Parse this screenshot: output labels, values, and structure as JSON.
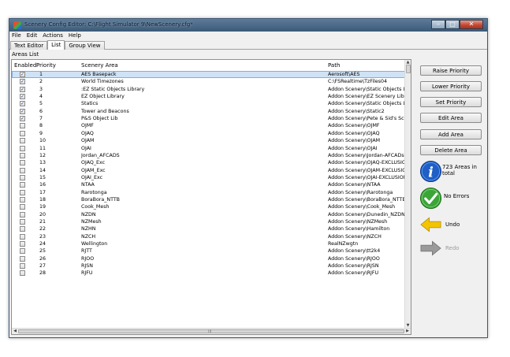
{
  "window": {
    "title": "Scenery Config Editor: C:\\Flight Simulator 9\\NewScenery.cfg*",
    "minimize": "–",
    "maximize": "□",
    "close": "✕"
  },
  "menu": [
    "File",
    "Edit",
    "Actions",
    "Help"
  ],
  "tabs": [
    "Text Editor",
    "List",
    "Group View"
  ],
  "group_label": "Areas List",
  "columns": {
    "enabled": "Enabled",
    "priority": "Priority",
    "area": "Scenery Area",
    "path": "Path"
  },
  "rows": [
    {
      "enabled": true,
      "priority": "1",
      "area": "AES Basepack",
      "path": "Aerosoft\\AES"
    },
    {
      "enabled": true,
      "priority": "2",
      "area": "World Timezones",
      "path": "C:\\FSRealtime\\TzFiles04"
    },
    {
      "enabled": true,
      "priority": "3",
      "area": ":EZ Static Objects Library",
      "path": "Addon Scenery\\Static Objects Libr"
    },
    {
      "enabled": true,
      "priority": "4",
      "area": "EZ Object Library",
      "path": "Addon Scenery\\EZ Scenery Library"
    },
    {
      "enabled": true,
      "priority": "5",
      "area": "Statics",
      "path": "Addon Scenery\\Static Objects Libr"
    },
    {
      "enabled": true,
      "priority": "6",
      "area": "Tower and Beacons",
      "path": "Addon Scenery\\Static2"
    },
    {
      "enabled": true,
      "priority": "7",
      "area": "P&S Object Lib",
      "path": "Addon Scenery\\Pete & Sid's Scen"
    },
    {
      "enabled": false,
      "priority": "8",
      "area": "OJMF",
      "path": "Addon Scenery\\OJMF"
    },
    {
      "enabled": false,
      "priority": "9",
      "area": "OJAQ",
      "path": "Addon Scenery\\OJAQ"
    },
    {
      "enabled": false,
      "priority": "10",
      "area": "OJAM",
      "path": "Addon Scenery\\OJAM"
    },
    {
      "enabled": false,
      "priority": "11",
      "area": "OJAI",
      "path": "Addon Scenery\\OJAI"
    },
    {
      "enabled": false,
      "priority": "12",
      "area": "Jordan_AFCADS",
      "path": "Addon Scenery\\Jordan-AFCADs-L"
    },
    {
      "enabled": false,
      "priority": "13",
      "area": "OJAQ_Exc",
      "path": "Addon Scenery\\OJAQ-EXCLUSION"
    },
    {
      "enabled": false,
      "priority": "14",
      "area": "OJAM_Exc",
      "path": "Addon Scenery\\OJAM-EXCLUSIOI"
    },
    {
      "enabled": false,
      "priority": "15",
      "area": "OJAI_Exc",
      "path": "Addon Scenery\\OJAI-EXCLUSION"
    },
    {
      "enabled": false,
      "priority": "16",
      "area": "NTAA",
      "path": "Addon Scenery\\NTAA"
    },
    {
      "enabled": false,
      "priority": "17",
      "area": "Rarotonga",
      "path": "Addon Scenery\\Rarotonga"
    },
    {
      "enabled": false,
      "priority": "18",
      "area": "BoraBora_NTTB",
      "path": "Addon Scenery\\BoraBora_NTTB"
    },
    {
      "enabled": false,
      "priority": "19",
      "area": "Cook_Mesh",
      "path": "Addon Scenery\\Cook_Mesh"
    },
    {
      "enabled": false,
      "priority": "20",
      "area": "NZDN",
      "path": "Addon Scenery\\Dunedin_NZDN"
    },
    {
      "enabled": false,
      "priority": "21",
      "area": "NZMesh",
      "path": "Addon Scenery\\NZMesh"
    },
    {
      "enabled": false,
      "priority": "22",
      "area": "NZHN",
      "path": "Addon Scenery\\Hamilton"
    },
    {
      "enabled": false,
      "priority": "23",
      "area": "NZCH",
      "path": "Addon Scenery\\NZCH"
    },
    {
      "enabled": false,
      "priority": "24",
      "area": "Wellington",
      "path": "RealNZwgtn"
    },
    {
      "enabled": false,
      "priority": "25",
      "area": "RJTT",
      "path": "Addon Scenery\\tt2k4"
    },
    {
      "enabled": false,
      "priority": "26",
      "area": "RJOO",
      "path": "Addon Scenery\\RJOO"
    },
    {
      "enabled": false,
      "priority": "27",
      "area": "RJSN",
      "path": "Addon Scenery\\RJSN"
    },
    {
      "enabled": false,
      "priority": "28",
      "area": "RJFU",
      "path": "Addon Scenery\\RJFU"
    }
  ],
  "selected_row": 0,
  "buttons": {
    "raise": "Raise Priority",
    "lower": "Lower Priority",
    "set": "Set Priority",
    "edit": "Edit Area",
    "add": "Add Area",
    "delete": "Delete Area"
  },
  "status": {
    "info": "723 Areas in total",
    "errors": "No Errors",
    "undo": "Undo",
    "redo": "Redo"
  },
  "colors": {
    "info": "#1f5fc6",
    "ok": "#3aa637",
    "undo": "#f2c500",
    "redo": "#9a9a9a"
  }
}
